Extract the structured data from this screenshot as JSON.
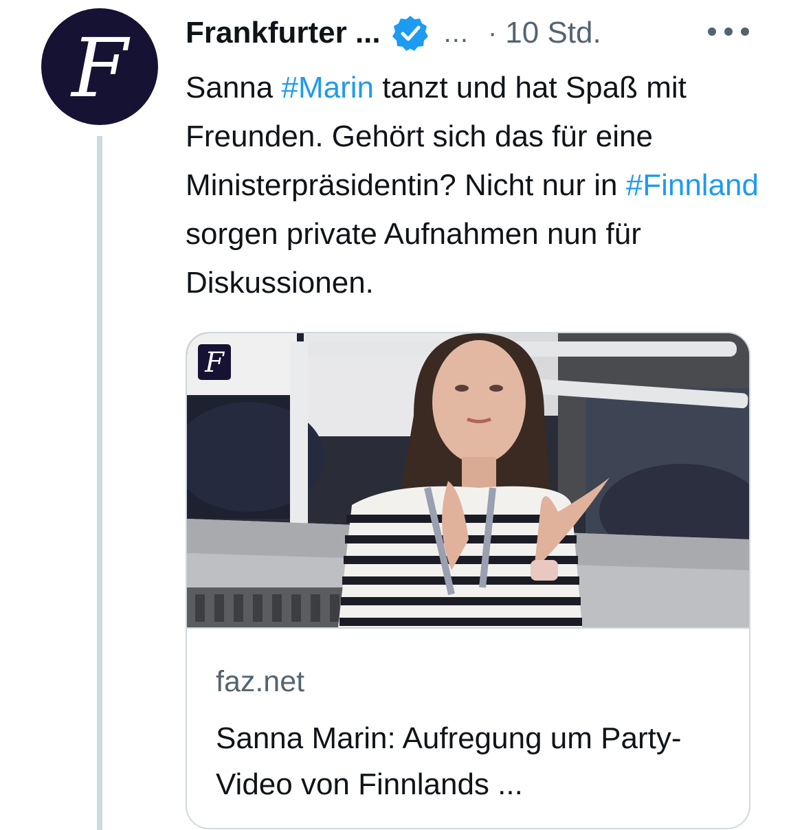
{
  "author": {
    "name": "Frankfurter ...",
    "handle": "...",
    "separator": "·",
    "time": "10 Std.",
    "avatar_icon": "faz-fraktur-f-logo",
    "avatar_letter": "F",
    "verified_icon": "verified-badge-icon",
    "more_icon": "more-options-icon"
  },
  "tweet": {
    "text_parts": [
      {
        "text": "Sanna ",
        "type": "text"
      },
      {
        "text": "#Marin",
        "type": "hashtag"
      },
      {
        "text": " tanzt und hat Spaß mit Freunden. Gehört sich das für eine Ministerpräsidentin? Nicht nur in ",
        "type": "text"
      },
      {
        "text": "#Finnland",
        "type": "hashtag"
      },
      {
        "text": " sorgen private Aufnahmen nun für Diskussionen.",
        "type": "text"
      }
    ]
  },
  "card": {
    "image_icon": "article-photo",
    "badge_letter": "F",
    "domain": "faz.net",
    "title": "Sanna Marin: Aufregung um Party-Video von Finnlands ..."
  },
  "colors": {
    "accent": "#1d9bf0",
    "text": "#0f1419",
    "secondary": "#536471",
    "border": "#cfd9de",
    "avatar_bg": "#161233"
  }
}
